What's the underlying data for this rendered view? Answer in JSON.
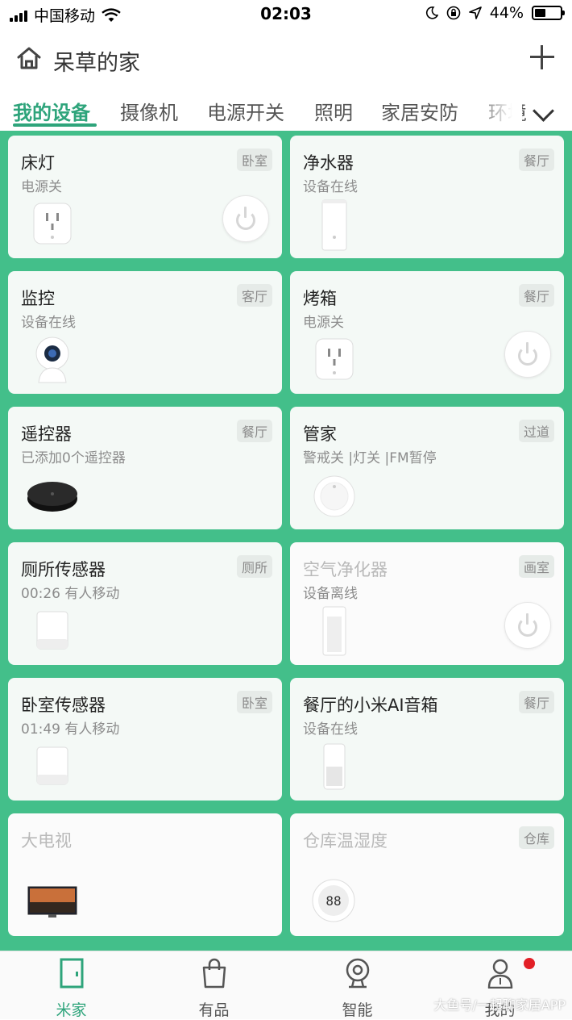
{
  "status_bar": {
    "carrier": "中国移动",
    "time": "02:03",
    "battery": "44%",
    "battery_level": 0.44
  },
  "header": {
    "title": "呆草的家"
  },
  "tabs": [
    {
      "label": "我的设备",
      "active": true
    },
    {
      "label": "摄像机"
    },
    {
      "label": "电源开关"
    },
    {
      "label": "照明"
    },
    {
      "label": "家居安防"
    },
    {
      "label": "环境"
    }
  ],
  "devices": [
    {
      "name": "床灯",
      "status": "电源关",
      "room": "卧室",
      "icon": "smart-plug-icon",
      "has_power_button": true
    },
    {
      "name": "净水器",
      "status": "设备在线",
      "room": "餐厅",
      "icon": "water-purifier-icon"
    },
    {
      "name": "监控",
      "status": "设备在线",
      "room": "客厅",
      "icon": "camera-icon"
    },
    {
      "name": "烤箱",
      "status": "电源关",
      "room": "餐厅",
      "icon": "smart-plug-icon",
      "has_power_button": true
    },
    {
      "name": "遥控器",
      "status": "已添加0个遥控器",
      "room": "餐厅",
      "icon": "ir-remote-icon"
    },
    {
      "name": "管家",
      "status": "警戒关 |灯关 |FM暂停",
      "room": "过道",
      "icon": "gateway-icon"
    },
    {
      "name": "厕所传感器",
      "status": "00:26 有人移动",
      "room": "厕所",
      "icon": "motion-sensor-icon"
    },
    {
      "name": "空气净化器",
      "status": "设备离线",
      "room": "画室",
      "icon": "air-purifier-icon",
      "has_power_button": true,
      "offline": true
    },
    {
      "name": "卧室传感器",
      "status": "01:49 有人移动",
      "room": "卧室",
      "icon": "motion-sensor-icon"
    },
    {
      "name": "餐厅的小米AI音箱",
      "status": "设备在线",
      "room": "餐厅",
      "icon": "speaker-icon"
    },
    {
      "name": "大电视",
      "status": "",
      "room": "",
      "icon": "tv-icon",
      "offline": true
    },
    {
      "name": "仓库温湿度",
      "status": "",
      "room": "仓库",
      "icon": "thermometer-icon",
      "offline": true,
      "display_text": "88"
    }
  ],
  "bottom_nav": [
    {
      "label": "米家",
      "icon": "door-icon",
      "active": true
    },
    {
      "label": "有品",
      "icon": "shopping-bag-icon"
    },
    {
      "label": "智能",
      "icon": "smart-icon"
    },
    {
      "label": "我的",
      "icon": "profile-icon",
      "has_badge": true
    }
  ],
  "watermark": "大鱼号/一起聊家居APP",
  "colors": {
    "accent": "#2ea47b",
    "grid_background": "#43bf8a",
    "badge_red": "#e21f26"
  }
}
